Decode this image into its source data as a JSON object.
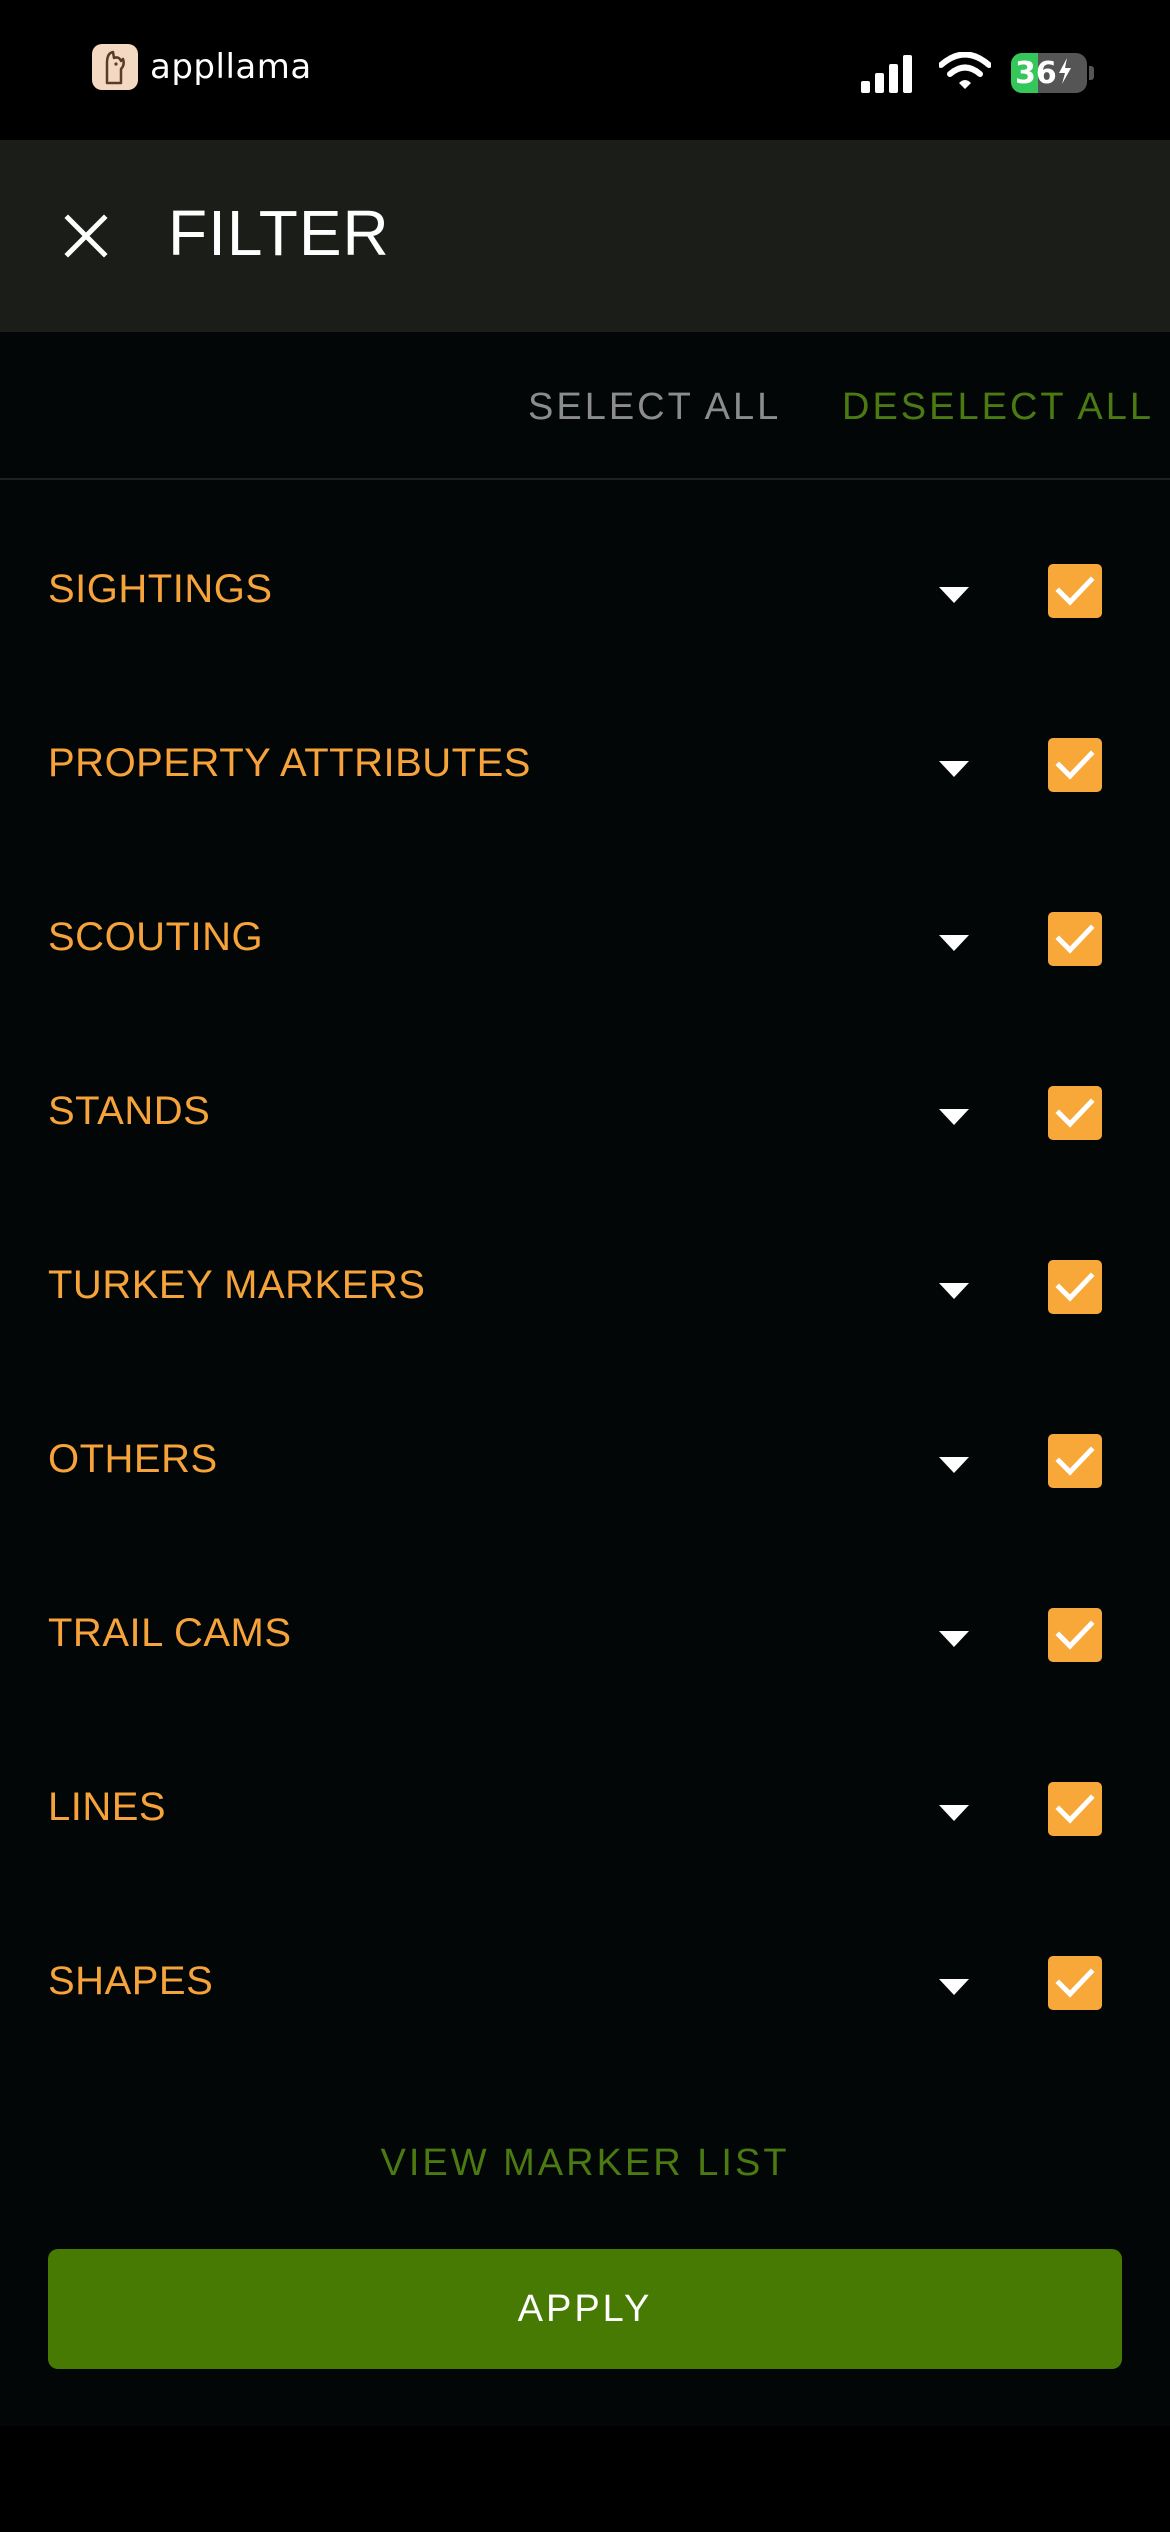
{
  "status_bar": {
    "app_name": "appllama",
    "battery_level": "36",
    "battery_fraction": 0.36,
    "battery_color": "#34c759",
    "icons": [
      "appllama-logo-icon",
      "cellular-signal-icon",
      "wifi-icon",
      "battery-charging-icon"
    ]
  },
  "header": {
    "title": "FILTER",
    "close_icon": "close-icon",
    "background": "#1b1e18"
  },
  "actions": {
    "select_all": "SELECT ALL",
    "deselect_all": "DESELECT ALL"
  },
  "categories": [
    {
      "label": "SIGHTINGS",
      "checked": true
    },
    {
      "label": "PROPERTY ATTRIBUTES",
      "checked": true
    },
    {
      "label": "SCOUTING",
      "checked": true
    },
    {
      "label": "STANDS",
      "checked": true
    },
    {
      "label": "TURKEY MARKERS",
      "checked": true
    },
    {
      "label": "OTHERS",
      "checked": true
    },
    {
      "label": "TRAIL CAMS",
      "checked": true
    },
    {
      "label": "LINES",
      "checked": true
    },
    {
      "label": "SHAPES",
      "checked": true
    }
  ],
  "footer": {
    "view_marker_list": "VIEW MARKER LIST",
    "apply": "APPLY"
  },
  "colors": {
    "accent_orange": "#f5a33a",
    "accent_green": "#467a02",
    "link_green": "#4b7a12",
    "muted_gray": "#8c8c8c"
  }
}
